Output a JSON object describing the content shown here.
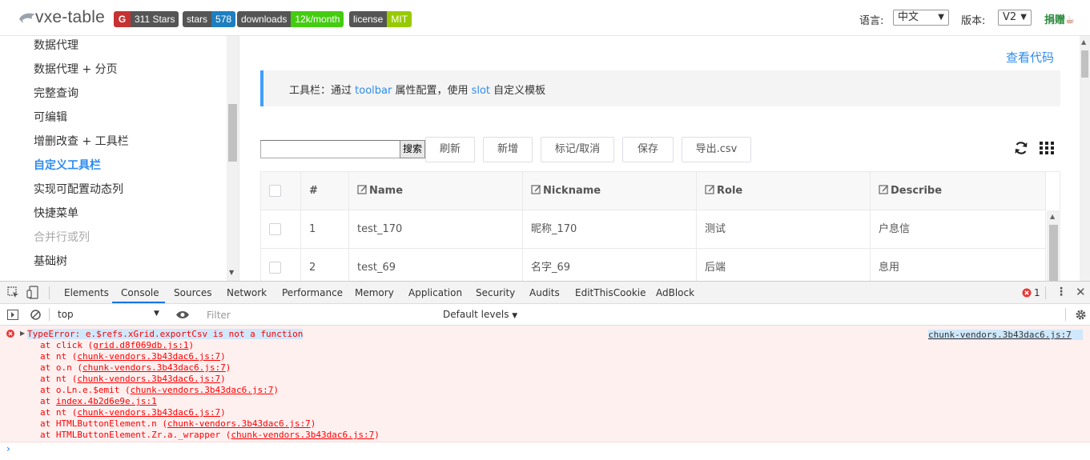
{
  "header": {
    "app_title": "vxe-table",
    "badges": {
      "stars_count": "311 Stars",
      "stars_label": "stars",
      "stars_value": "578",
      "downloads_label": "downloads",
      "downloads_value": "12k/month",
      "license_label": "license",
      "license_value": "MIT"
    },
    "language_label": "语言:",
    "language_value": "中文",
    "version_label": "版本:",
    "version_value": "V2",
    "donate_label": "捐赠"
  },
  "sidebar": {
    "items": [
      {
        "label": "数据代理",
        "state": "normal"
      },
      {
        "label": "数据代理 + 分页",
        "state": "normal"
      },
      {
        "label": "完整查询",
        "state": "normal"
      },
      {
        "label": "可编辑",
        "state": "normal"
      },
      {
        "label": "增删改查 + 工具栏",
        "state": "normal"
      },
      {
        "label": "自定义工具栏",
        "state": "active"
      },
      {
        "label": "实现可配置动态列",
        "state": "normal"
      },
      {
        "label": "快捷菜单",
        "state": "normal"
      },
      {
        "label": "合并行或列",
        "state": "disabled"
      },
      {
        "label": "基础树",
        "state": "normal"
      }
    ]
  },
  "main": {
    "view_code_link": "查看代码",
    "tip": {
      "prefix": "工具栏：通过 ",
      "kw1": "toolbar",
      "middle": " 属性配置，使用 ",
      "kw2": "slot",
      "suffix": " 自定义模板"
    },
    "toolbar": {
      "search_value": "",
      "search_button": "搜索",
      "refresh": "刷新",
      "add": "新增",
      "mark_cancel": "标记/取消",
      "save": "保存",
      "export_csv": "导出.csv"
    },
    "grid": {
      "columns": [
        "#",
        "Name",
        "Nickname",
        "Role",
        "Describe"
      ],
      "rows": [
        {
          "seq": "1",
          "name": "test_170",
          "nickname": "昵称_170",
          "role": "测试",
          "describe": "户息信"
        },
        {
          "seq": "2",
          "name": "test_69",
          "nickname": "名字_69",
          "role": "后端",
          "describe": "息用"
        }
      ]
    }
  },
  "devtools": {
    "tabs": [
      "Elements",
      "Console",
      "Sources",
      "Network",
      "Performance",
      "Memory",
      "Application",
      "Security",
      "Audits",
      "EditThisCookie",
      "AdBlock"
    ],
    "active_tab": "Console",
    "error_count": "1",
    "context": "top",
    "filter_placeholder": "Filter",
    "levels": "Default levels",
    "error_source": "chunk-vendors.3b43dac6.js:7",
    "error_message": "TypeError: e.$refs.xGrid.exportCsv is not a function",
    "stack": [
      {
        "prefix": "at click (",
        "link": "grid.d8f069db.js:1",
        "suffix": ")"
      },
      {
        "prefix": "at nt (",
        "link": "chunk-vendors.3b43dac6.js:7",
        "suffix": ")"
      },
      {
        "prefix": "at o.n (",
        "link": "chunk-vendors.3b43dac6.js:7",
        "suffix": ")"
      },
      {
        "prefix": "at nt (",
        "link": "chunk-vendors.3b43dac6.js:7",
        "suffix": ")"
      },
      {
        "prefix": "at o.Ln.e.$emit (",
        "link": "chunk-vendors.3b43dac6.js:7",
        "suffix": ")"
      },
      {
        "prefix": "at ",
        "link": "index.4b2d6e9e.js:1",
        "suffix": ""
      },
      {
        "prefix": "at nt (",
        "link": "chunk-vendors.3b43dac6.js:7",
        "suffix": ")"
      },
      {
        "prefix": "at HTMLButtonElement.n (",
        "link": "chunk-vendors.3b43dac6.js:7",
        "suffix": ")"
      },
      {
        "prefix": "at HTMLButtonElement.Zr.a._wrapper (",
        "link": "chunk-vendors.3b43dac6.js:7",
        "suffix": ")"
      }
    ],
    "prompt": "›"
  },
  "colors": {
    "accent": "#2d8cf0",
    "error": "#ff0000",
    "error_bg": "#fff0f0"
  }
}
